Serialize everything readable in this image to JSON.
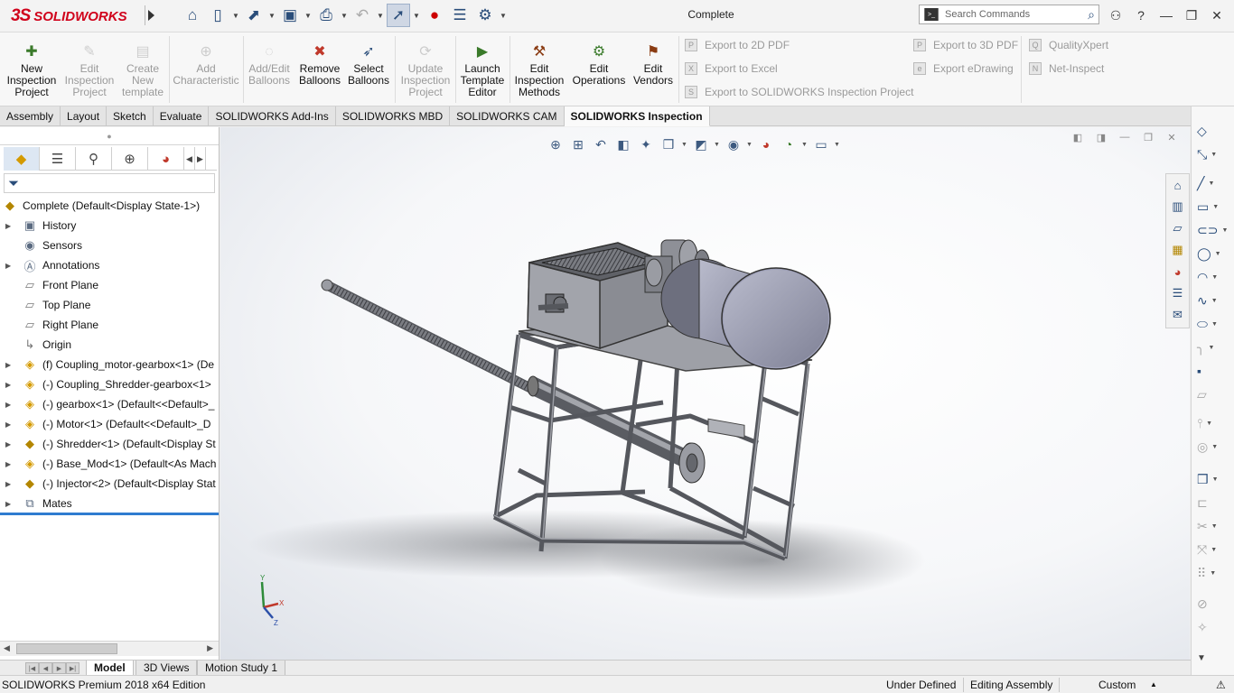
{
  "app": {
    "logo_mark": "3S",
    "logo_text": "SOLIDWORKS",
    "document_title": "Complete",
    "search_placeholder": "Search Commands",
    "help_label": "?"
  },
  "ribbon": {
    "buttons": [
      {
        "label": "New\nInspection\nProject",
        "icon": "new-inspection-icon",
        "enabled": true
      },
      {
        "label": "Edit\nInspection\nProject",
        "icon": "edit-inspection-icon",
        "enabled": false
      },
      {
        "label": "Create\nNew\ntemplate",
        "icon": "create-template-icon",
        "enabled": false
      },
      {
        "label": "Add\nCharacteristic",
        "icon": "add-characteristic-icon",
        "enabled": false
      },
      {
        "label": "Add/Edit\nBalloons",
        "icon": "add-balloons-icon",
        "enabled": false
      },
      {
        "label": "Remove\nBalloons",
        "icon": "remove-balloons-icon",
        "enabled": true
      },
      {
        "label": "Select\nBalloons",
        "icon": "select-balloons-icon",
        "enabled": true
      },
      {
        "label": "Update\nInspection\nProject",
        "icon": "update-inspection-icon",
        "enabled": false
      },
      {
        "label": "Launch\nTemplate\nEditor",
        "icon": "launch-template-editor-icon",
        "enabled": true
      },
      {
        "label": "Edit\nInspection\nMethods",
        "icon": "edit-methods-icon",
        "enabled": true
      },
      {
        "label": "Edit\nOperations",
        "icon": "edit-operations-icon",
        "enabled": true
      },
      {
        "label": "Edit\nVendors",
        "icon": "edit-vendors-icon",
        "enabled": true
      }
    ],
    "export_col1": [
      "Export to 2D PDF",
      "Export to Excel",
      "Export to SOLIDWORKS Inspection Project"
    ],
    "export_col2": [
      "Export to 3D PDF",
      "Export eDrawing"
    ],
    "export_col3": [
      "QualityXpert",
      "Net-Inspect"
    ]
  },
  "command_tabs": [
    "Assembly",
    "Layout",
    "Sketch",
    "Evaluate",
    "SOLIDWORKS Add-Ins",
    "SOLIDWORKS MBD",
    "SOLIDWORKS CAM",
    "SOLIDWORKS Inspection"
  ],
  "active_command_tab": "SOLIDWORKS Inspection",
  "tree": {
    "root": "Complete  (Default<Display State-1>)",
    "items": [
      {
        "label": "History",
        "icon": "history-folder-icon",
        "expandable": true
      },
      {
        "label": "Sensors",
        "icon": "sensors-icon",
        "expandable": false
      },
      {
        "label": "Annotations",
        "icon": "annotations-icon",
        "expandable": true
      },
      {
        "label": "Front Plane",
        "icon": "plane-icon",
        "expandable": false
      },
      {
        "label": "Top Plane",
        "icon": "plane-icon",
        "expandable": false
      },
      {
        "label": "Right Plane",
        "icon": "plane-icon",
        "expandable": false
      },
      {
        "label": "Origin",
        "icon": "origin-icon",
        "expandable": false
      },
      {
        "label": "(f) Coupling_motor-gearbox<1> (De",
        "icon": "part-icon",
        "expandable": true
      },
      {
        "label": "(-) Coupling_Shredder-gearbox<1>",
        "icon": "part-icon",
        "expandable": true
      },
      {
        "label": "(-) gearbox<1> (Default<<Default>_",
        "icon": "part-icon",
        "expandable": true
      },
      {
        "label": "(-) Motor<1> (Default<<Default>_D",
        "icon": "part-icon",
        "expandable": true
      },
      {
        "label": "(-) Shredder<1> (Default<Display St",
        "icon": "assembly-icon",
        "expandable": true
      },
      {
        "label": "(-) Base_Mod<1> (Default<As Mach",
        "icon": "part-icon",
        "expandable": true
      },
      {
        "label": "(-) Injector<2> (Default<Display Stat",
        "icon": "assembly-icon",
        "expandable": true
      },
      {
        "label": "Mates",
        "icon": "mates-icon",
        "expandable": true
      }
    ]
  },
  "bottom_tabs": [
    "Model",
    "3D Views",
    "Motion Study 1"
  ],
  "active_bottom_tab": "Model",
  "status": {
    "edition": "SOLIDWORKS Premium 2018 x64 Edition",
    "definition": "Under Defined",
    "mode": "Editing Assembly",
    "units": "Custom"
  },
  "triad": {
    "x": "X",
    "y": "Y",
    "z": "Z"
  },
  "colors": {
    "brand": "#d0021b",
    "accent": "#2f7bd0",
    "model_gray": "#8c8e96",
    "motor": "#9a9cb3"
  }
}
